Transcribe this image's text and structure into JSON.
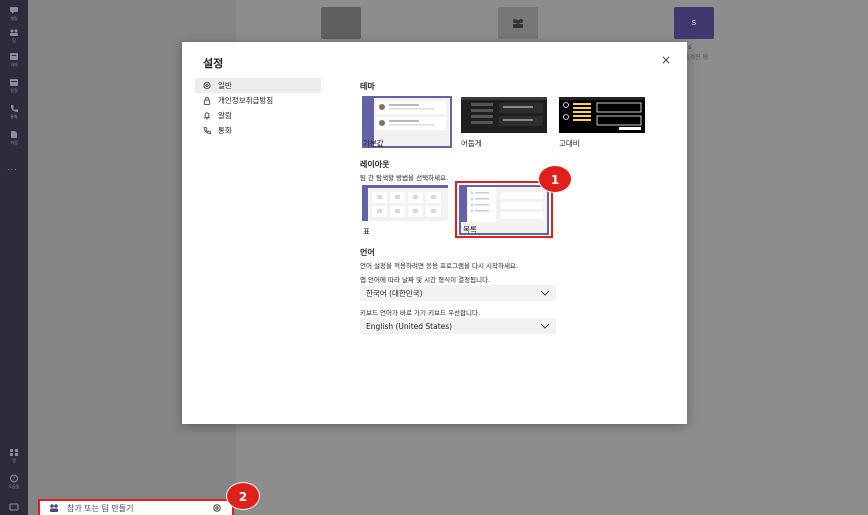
{
  "rail": {
    "items": [
      {
        "label": "채팅",
        "icon": "chat-icon"
      },
      {
        "label": "팀",
        "icon": "teams-icon"
      },
      {
        "label": "과제",
        "icon": "assignments-icon"
      },
      {
        "label": "일정",
        "icon": "calendar-icon"
      },
      {
        "label": "통화",
        "icon": "calls-icon"
      },
      {
        "label": "파일",
        "icon": "files-icon"
      }
    ],
    "more": "...",
    "bottom": [
      {
        "label": "앱",
        "icon": "apps-icon"
      },
      {
        "label": "도움말",
        "icon": "help-icon"
      }
    ]
  },
  "background": {
    "tile3_letter": "s",
    "tile3_label": "s",
    "tile3_sub": "숨겨진 팀"
  },
  "joinbar": {
    "label": "참가 또는 팀 만들기",
    "badge": "2"
  },
  "dialog": {
    "title": "설정",
    "close": "×",
    "nav": [
      {
        "label": "일반",
        "icon": "gear-icon",
        "active": true
      },
      {
        "label": "개인정보취급방침",
        "icon": "lock-icon"
      },
      {
        "label": "알림",
        "icon": "bell-icon"
      },
      {
        "label": "통화",
        "icon": "phone-icon"
      }
    ],
    "theme": {
      "heading": "테마",
      "options": [
        "기본값",
        "어둡게",
        "고대비"
      ]
    },
    "layout": {
      "heading": "레이아웃",
      "description": "팀 간 탐색할 방법을 선택하세요.",
      "options": [
        "표",
        "목록"
      ],
      "badge": "1"
    },
    "language": {
      "heading": "언어",
      "restart_note": "언어 설정을 적용하려면 응용 프로그램을 다시 시작하세요.",
      "app_lang_note": "앱 언어에 따라 날짜 및 시간 형식이 결정됩니다.",
      "app_lang_value": "한국어 (대한민국)",
      "keyboard_note": "키보드 언어가 바로 가기 키보드 우선합니다.",
      "keyboard_value": "English (United States)"
    }
  },
  "colors": {
    "rail": "#2d2c3a",
    "accent": "#6264a7",
    "highlight": "#e0201b"
  }
}
